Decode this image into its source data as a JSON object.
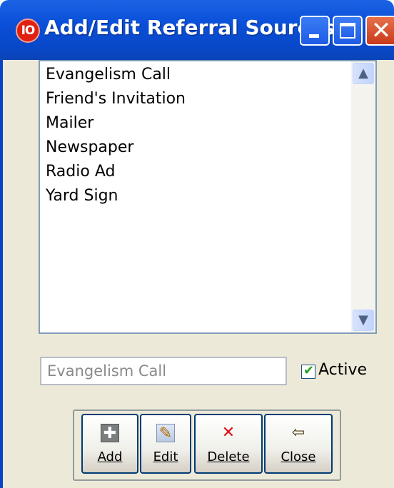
{
  "window": {
    "app_icon_text": "IO",
    "title": "Add/Edit Referral Sources",
    "close_glyph": "✕"
  },
  "list": {
    "items": [
      "Evangelism Call",
      "Friend's Invitation",
      "Mailer",
      "Newspaper",
      "Radio Ad",
      "Yard Sign"
    ],
    "scroll_up": "▲",
    "scroll_down": "▼"
  },
  "editor": {
    "value": "Evangelism Call",
    "active_label": "Active",
    "active_checked": true
  },
  "toolbar": {
    "add_label": "Add",
    "edit_label": "Edit",
    "delete_label": "Delete",
    "close_label": "Close",
    "add_icon": "plus-icon",
    "edit_icon": "pencil-edit-icon",
    "delete_icon": "red-x-icon",
    "close_icon": "exit-door-icon"
  },
  "colors": {
    "titlebar": "#0a4fd8",
    "close_button": "#c93a1a",
    "body_background": "#ece9d8",
    "checkmark": "#21a121"
  }
}
